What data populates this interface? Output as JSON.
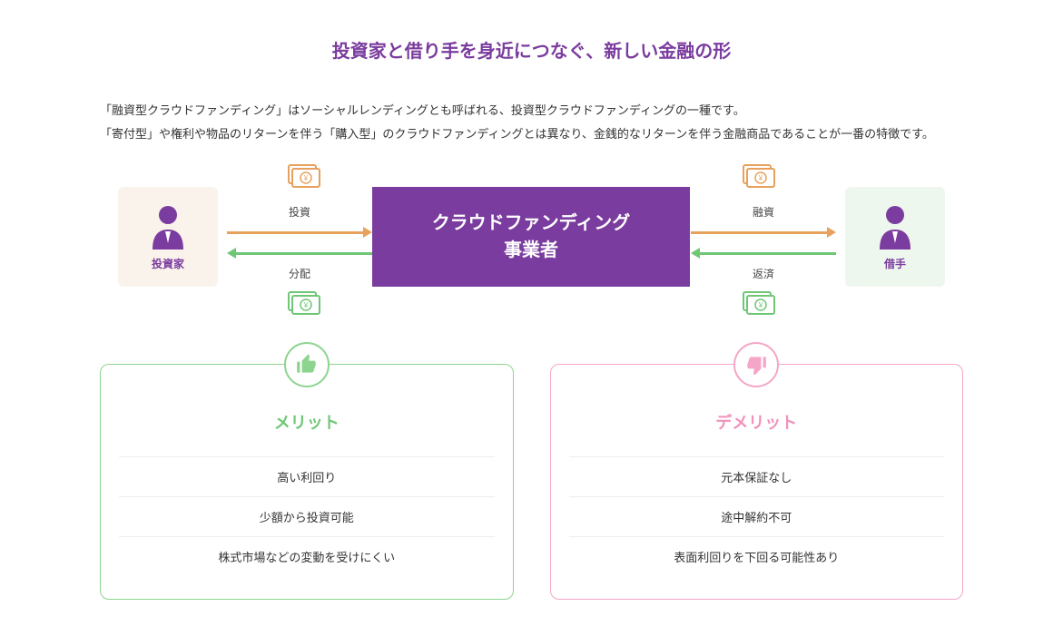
{
  "title": "投資家と借り手を身近につなぐ、新しい金融の形",
  "description": {
    "line1": "「融資型クラウドファンディング」はソーシャルレンディングとも呼ばれる、投資型クラウドファンディングの一種です。",
    "line2": "「寄付型」や権利や物品のリターンを伴う「購入型」のクラウドファンディングとは異なり、金銭的なリターンを伴う金融商品であることが一番の特徴です。"
  },
  "diagram": {
    "investor_label": "投資家",
    "borrower_label": "借手",
    "center_line1": "クラウドファンディング",
    "center_line2": "事業者",
    "arrows": {
      "invest": "投資",
      "distribute": "分配",
      "finance": "融資",
      "repay": "返済"
    }
  },
  "merit": {
    "title": "メリット",
    "items": [
      "高い利回り",
      "少額から投資可能",
      "株式市場などの変動を受けにくい"
    ]
  },
  "demerit": {
    "title": "デメリット",
    "items": [
      "元本保証なし",
      "途中解約不可",
      "表面利回りを下回る可能性あり"
    ]
  }
}
